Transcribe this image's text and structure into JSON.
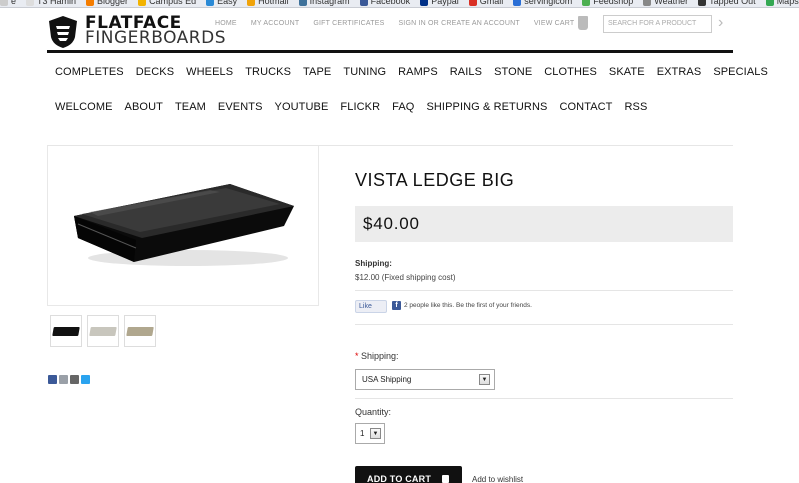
{
  "bookmarks": [
    {
      "label": "e",
      "icon": "page-icon",
      "color": "#cccccc"
    },
    {
      "label": "T3 Hamin",
      "icon": "page-icon",
      "color": "#dddddd"
    },
    {
      "label": "Blogger",
      "icon": "blogger-icon",
      "color": "#f57d00"
    },
    {
      "label": "Campus Ed",
      "icon": "campus-icon",
      "color": "#f2b300"
    },
    {
      "label": "Easy",
      "icon": "easy-icon",
      "color": "#2a8ad6"
    },
    {
      "label": "Hotmail",
      "icon": "hotmail-icon",
      "color": "#f0a30a"
    },
    {
      "label": "Instagram",
      "icon": "instagram-icon",
      "color": "#3f729b"
    },
    {
      "label": "Facebook",
      "icon": "facebook-icon",
      "color": "#3b5998"
    },
    {
      "label": "Paypal",
      "icon": "paypal-icon",
      "color": "#003087"
    },
    {
      "label": "Gmail",
      "icon": "gmail-icon",
      "color": "#d93025"
    },
    {
      "label": "servinglcom",
      "icon": "page-icon",
      "color": "#2a6fd6"
    },
    {
      "label": "Feedshop",
      "icon": "feed-icon",
      "color": "#4caf50"
    },
    {
      "label": "Weather",
      "icon": "weather-icon",
      "color": "#888888"
    },
    {
      "label": "Tapped Out",
      "icon": "tapped-icon",
      "color": "#333333"
    },
    {
      "label": "Maps",
      "icon": "maps-icon",
      "color": "#34a853"
    }
  ],
  "header": {
    "logo_line1": "FLATFACE",
    "logo_line2": "FINGERBOARDS",
    "top_links": [
      "HOME",
      "MY ACCOUNT",
      "GIFT CERTIFICATES",
      "SIGN IN OR CREATE AN ACCOUNT",
      "VIEW CART"
    ],
    "search_placeholder": "SEARCH FOR A PRODUCT"
  },
  "nav": {
    "row1": [
      "COMPLETES",
      "DECKS",
      "WHEELS",
      "TRUCKS",
      "TAPE",
      "TUNING",
      "RAMPS",
      "RAILS",
      "STONE",
      "CLOTHES",
      "SKATE",
      "EXTRAS",
      "SPECIALS"
    ],
    "row2": [
      "WELCOME",
      "ABOUT",
      "TEAM",
      "EVENTS",
      "YOUTUBE",
      "FLICKR",
      "FAQ",
      "SHIPPING & RETURNS",
      "CONTACT",
      "RSS"
    ]
  },
  "product": {
    "title": "VISTA LEDGE BIG",
    "price": "$40.00",
    "shipping_label": "Shipping:",
    "shipping_cost": "$12.00 (Fixed shipping cost)",
    "like_button": "Like",
    "like_text": "2 people like this. Be the first of your friends.",
    "shipping_select_label": "Shipping:",
    "required_mark": "*",
    "shipping_option": "USA Shipping",
    "quantity_label": "Quantity:",
    "quantity_value": "1",
    "add_to_cart": "ADD TO CART",
    "wishlist": "Add to wishlist",
    "thumb_colors": [
      "#111111",
      "#c8c6bd",
      "#b0a78e"
    ]
  },
  "share_icons": [
    {
      "icon": "facebook-icon",
      "color": "#3b5998"
    },
    {
      "icon": "email-icon",
      "color": "#9aa0a8"
    },
    {
      "icon": "print-icon",
      "color": "#666666"
    },
    {
      "icon": "twitter-icon",
      "color": "#2aa3ef"
    }
  ]
}
